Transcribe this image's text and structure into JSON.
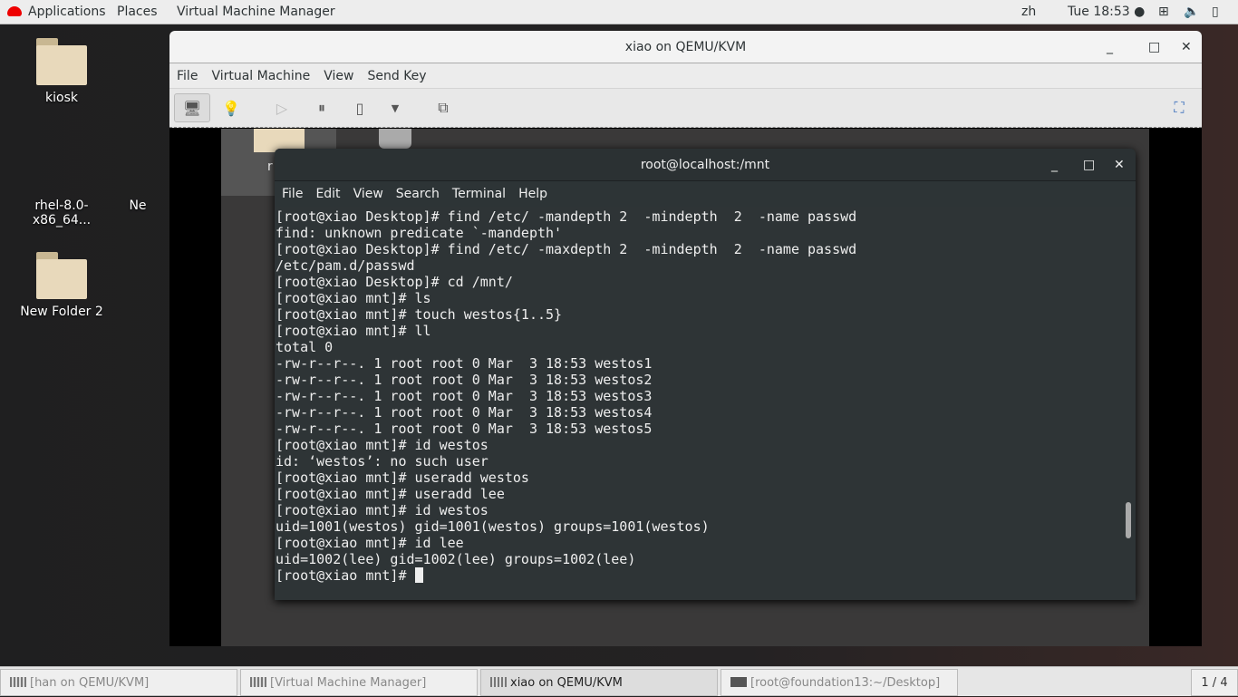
{
  "topbar": {
    "applications": "Applications",
    "places": "Places",
    "app_menu": "Virtual Machine Manager",
    "lang": "zh",
    "clock": "Tue 18:53 ●"
  },
  "desktop": {
    "icons": [
      "kiosk",
      "rhel-8.0-x86_64...",
      "Ne",
      "New Folder 2"
    ]
  },
  "vm_window": {
    "title": "xiao on QEMU/KVM",
    "menu": [
      "File",
      "Virtual Machine",
      "View",
      "Send Key"
    ]
  },
  "guest": {
    "icon_label": "r"
  },
  "terminal": {
    "title": "root@localhost:/mnt",
    "menu": [
      "File",
      "Edit",
      "View",
      "Search",
      "Terminal",
      "Help"
    ],
    "lines": [
      "[root@xiao Desktop]# find /etc/ -mandepth 2  -mindepth  2  -name passwd",
      "find: unknown predicate `-mandepth'",
      "[root@xiao Desktop]# find /etc/ -maxdepth 2  -mindepth  2  -name passwd",
      "/etc/pam.d/passwd",
      "[root@xiao Desktop]# cd /mnt/",
      "[root@xiao mnt]# ls",
      "[root@xiao mnt]# touch westos{1..5}",
      "[root@xiao mnt]# ll",
      "total 0",
      "-rw-r--r--. 1 root root 0 Mar  3 18:53 westos1",
      "-rw-r--r--. 1 root root 0 Mar  3 18:53 westos2",
      "-rw-r--r--. 1 root root 0 Mar  3 18:53 westos3",
      "-rw-r--r--. 1 root root 0 Mar  3 18:53 westos4",
      "-rw-r--r--. 1 root root 0 Mar  3 18:53 westos5",
      "[root@xiao mnt]# id westos",
      "id: ‘westos’: no such user",
      "[root@xiao mnt]# useradd westos",
      "[root@xiao mnt]# useradd lee",
      "[root@xiao mnt]# id westos",
      "uid=1001(westos) gid=1001(westos) groups=1001(westos)",
      "[root@xiao mnt]# id lee",
      "uid=1002(lee) gid=1002(lee) groups=1002(lee)"
    ],
    "prompt": "[root@xiao mnt]# "
  },
  "taskbar": {
    "tasks": [
      "[han on QEMU/KVM]",
      "[Virtual Machine Manager]",
      "xiao on QEMU/KVM",
      "[root@foundation13:~/Desktop]"
    ],
    "workspace": "1 / 4"
  }
}
